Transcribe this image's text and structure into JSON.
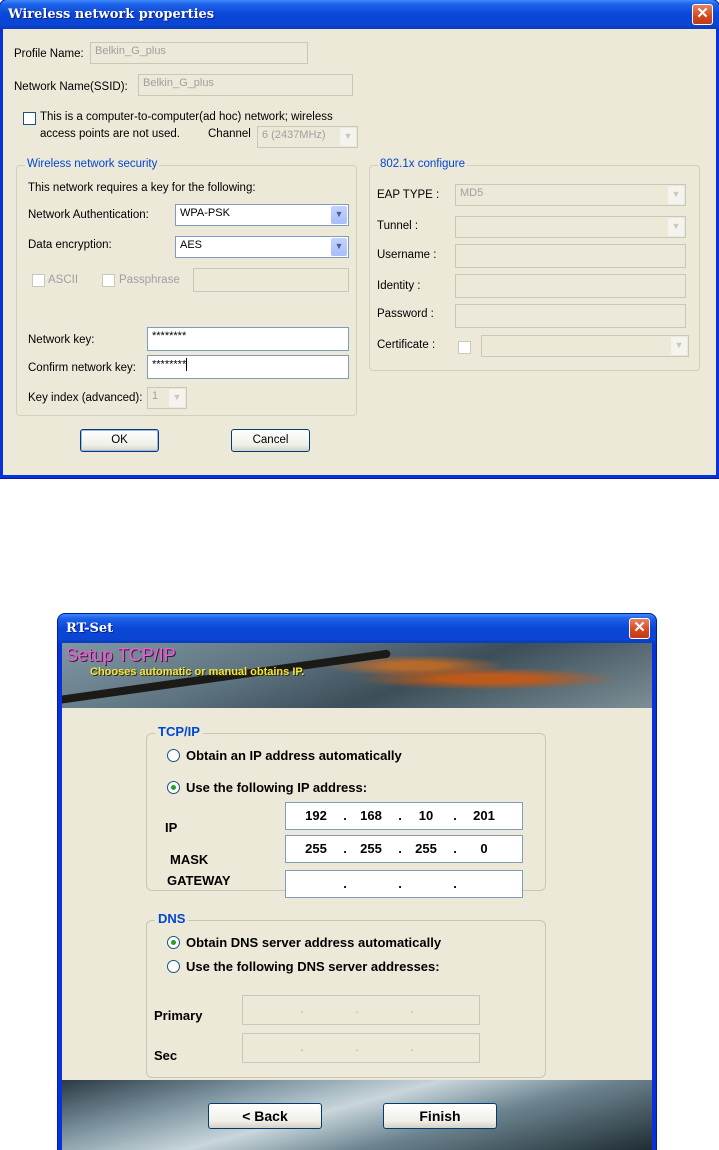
{
  "wireless_dialog": {
    "title": "Wireless network properties",
    "close_glyph": "✕",
    "profile_label": "Profile Name:",
    "profile_value": "Belkin_G_plus",
    "ssid_label": "Network Name(SSID):",
    "ssid_value": "Belkin_G_plus",
    "adhoc_line1": "This is a computer-to-computer(ad hoc) network; wireless",
    "adhoc_line2": "access points are not used.",
    "channel_label": "Channel",
    "channel_value": "6 (2437MHz)",
    "security": {
      "title": "Wireless network security",
      "requires_text": "This network requires a key for the following:",
      "auth_label": "Network Authentication:",
      "auth_value": "WPA-PSK",
      "enc_label": "Data encryption:",
      "enc_value": "AES",
      "ascii_label": "ASCII",
      "passphrase_label": "Passphrase",
      "key_label": "Network key:",
      "key_value": "********",
      "confirm_label": "Confirm network key:",
      "confirm_value": "********",
      "index_label": "Key index (advanced):",
      "index_value": "1"
    },
    "dot1x": {
      "title": "802.1x configure",
      "eap_label": "EAP TYPE :",
      "eap_value": "MD5",
      "tunnel_label": "Tunnel :",
      "username_label": "Username :",
      "identity_label": "Identity :",
      "password_label": "Password :",
      "certificate_label": "Certificate :"
    },
    "ok_label": "OK",
    "cancel_label": "Cancel"
  },
  "rtset_dialog": {
    "title": "RT-Set",
    "close_glyph": "✕",
    "banner_title": "Setup TCP/IP",
    "banner_subtitle": "Chooses automatic or manual obtains IP.",
    "tcpip": {
      "title": "TCP/IP",
      "auto_label": "Obtain an IP address automatically",
      "manual_label": "Use the following IP address:",
      "ip_label": "IP",
      "ip_octets": [
        "192",
        "168",
        "10",
        "201"
      ],
      "mask_label": "MASK",
      "mask_octets": [
        "255",
        "255",
        "255",
        "0"
      ],
      "gateway_label": "GATEWAY",
      "dot": "."
    },
    "dns": {
      "title": "DNS",
      "auto_label": "Obtain DNS server address automatically",
      "manual_label": "Use the following DNS server addresses:",
      "primary_label": "Primary",
      "sec_label": "Sec",
      "dot": "."
    },
    "back_label": "< Back",
    "finish_label": "Finish"
  }
}
